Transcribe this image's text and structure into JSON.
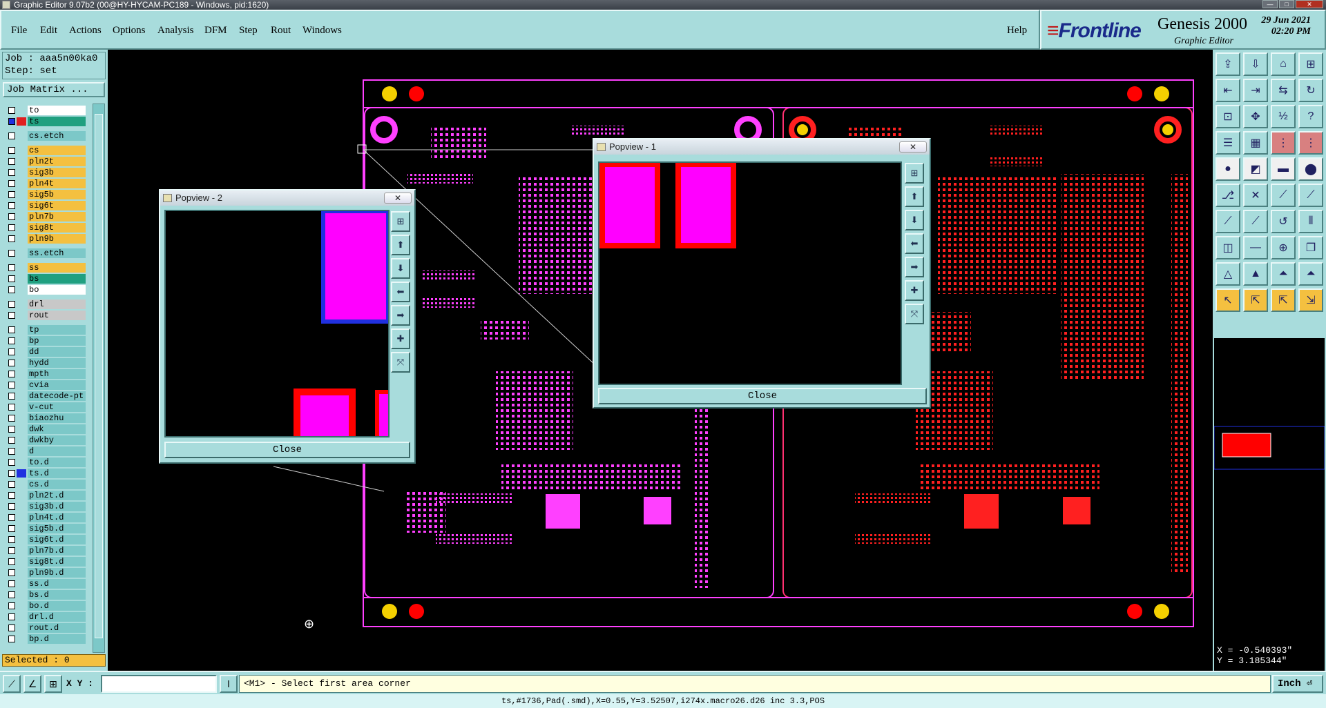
{
  "window": {
    "title": "Graphic Editor 9.07b2 (00@HY-HYCAM-PC189 - Windows, pid:1620)"
  },
  "menu": {
    "items": [
      "File",
      "Edit",
      "Actions",
      "Options",
      "Analysis",
      "DFM",
      "Step",
      "Rout",
      "Windows"
    ],
    "help": "Help"
  },
  "brand": {
    "logo": "Frontline",
    "product": "Genesis 2000",
    "subtitle": "Graphic Editor",
    "date": "29 Jun 2021",
    "time": "02:20 PM"
  },
  "job": {
    "job_line": "Job : aaa5n00ka0",
    "step_line": "Step: set",
    "matrix_button": "Job Matrix ..."
  },
  "layers": [
    {
      "name": "to",
      "color": "#ffffff",
      "swatch": "",
      "group": 1
    },
    {
      "name": "ts",
      "color": "#20a080",
      "swatch": "#e02020",
      "group": 1,
      "active": true
    },
    {
      "name": "cs.etch",
      "color": "#7cc8c8",
      "swatch": "",
      "group": 2
    },
    {
      "name": "cs",
      "color": "#f4c040",
      "swatch": "",
      "group": 3
    },
    {
      "name": "pln2t",
      "color": "#f4c040",
      "swatch": "",
      "group": 3
    },
    {
      "name": "sig3b",
      "color": "#f4c040",
      "swatch": "",
      "group": 3
    },
    {
      "name": "pln4t",
      "color": "#f4c040",
      "swatch": "",
      "group": 3
    },
    {
      "name": "sig5b",
      "color": "#f4c040",
      "swatch": "",
      "group": 3
    },
    {
      "name": "sig6t",
      "color": "#f4c040",
      "swatch": "",
      "group": 3
    },
    {
      "name": "pln7b",
      "color": "#f4c040",
      "swatch": "",
      "group": 3
    },
    {
      "name": "sig8t",
      "color": "#f4c040",
      "swatch": "",
      "group": 3
    },
    {
      "name": "pln9b",
      "color": "#f4c040",
      "swatch": "",
      "group": 3
    },
    {
      "name": "ss.etch",
      "color": "#7cc8c8",
      "swatch": "",
      "group": 4
    },
    {
      "name": "ss",
      "color": "#f4c040",
      "swatch": "",
      "group": 5
    },
    {
      "name": "bs",
      "color": "#20a080",
      "swatch": "",
      "group": 5
    },
    {
      "name": "bo",
      "color": "#ffffff",
      "swatch": "",
      "group": 5
    },
    {
      "name": "drl",
      "color": "#c8c8c8",
      "swatch": "",
      "group": 6
    },
    {
      "name": "rout",
      "color": "#c8c8c8",
      "swatch": "",
      "group": 6
    },
    {
      "name": "tp",
      "color": "#7cc8c8",
      "swatch": "",
      "group": 7
    },
    {
      "name": "bp",
      "color": "#7cc8c8",
      "swatch": "",
      "group": 7
    },
    {
      "name": "dd",
      "color": "#7cc8c8",
      "swatch": "",
      "group": 7
    },
    {
      "name": "hydd",
      "color": "#7cc8c8",
      "swatch": "",
      "group": 7
    },
    {
      "name": "mpth",
      "color": "#7cc8c8",
      "swatch": "",
      "group": 7
    },
    {
      "name": "cvia",
      "color": "#7cc8c8",
      "swatch": "",
      "group": 7
    },
    {
      "name": "datecode-pt",
      "color": "#7cc8c8",
      "swatch": "",
      "group": 7
    },
    {
      "name": "v-cut",
      "color": "#7cc8c8",
      "swatch": "",
      "group": 7
    },
    {
      "name": "biaozhu",
      "color": "#7cc8c8",
      "swatch": "",
      "group": 7
    },
    {
      "name": "dwk",
      "color": "#7cc8c8",
      "swatch": "",
      "group": 7
    },
    {
      "name": "dwkby",
      "color": "#7cc8c8",
      "swatch": "",
      "group": 7
    },
    {
      "name": "d",
      "color": "#7cc8c8",
      "swatch": "",
      "group": 7
    },
    {
      "name": "to.d",
      "color": "#7cc8c8",
      "swatch": "",
      "group": 7
    },
    {
      "name": "ts.d",
      "color": "#7cc8c8",
      "swatch": "#2030e0",
      "group": 7
    },
    {
      "name": "cs.d",
      "color": "#7cc8c8",
      "swatch": "",
      "group": 7
    },
    {
      "name": "pln2t.d",
      "color": "#7cc8c8",
      "swatch": "",
      "group": 7
    },
    {
      "name": "sig3b.d",
      "color": "#7cc8c8",
      "swatch": "",
      "group": 7
    },
    {
      "name": "pln4t.d",
      "color": "#7cc8c8",
      "swatch": "",
      "group": 7
    },
    {
      "name": "sig5b.d",
      "color": "#7cc8c8",
      "swatch": "",
      "group": 7
    },
    {
      "name": "sig6t.d",
      "color": "#7cc8c8",
      "swatch": "",
      "group": 7
    },
    {
      "name": "pln7b.d",
      "color": "#7cc8c8",
      "swatch": "",
      "group": 7
    },
    {
      "name": "sig8t.d",
      "color": "#7cc8c8",
      "swatch": "",
      "group": 7
    },
    {
      "name": "pln9b.d",
      "color": "#7cc8c8",
      "swatch": "",
      "group": 7
    },
    {
      "name": "ss.d",
      "color": "#7cc8c8",
      "swatch": "",
      "group": 7
    },
    {
      "name": "bs.d",
      "color": "#7cc8c8",
      "swatch": "",
      "group": 7
    },
    {
      "name": "bo.d",
      "color": "#7cc8c8",
      "swatch": "",
      "group": 7
    },
    {
      "name": "drl.d",
      "color": "#7cc8c8",
      "swatch": "",
      "group": 7
    },
    {
      "name": "rout.d",
      "color": "#7cc8c8",
      "swatch": "",
      "group": 7
    },
    {
      "name": "bp.d",
      "color": "#7cc8c8",
      "swatch": "",
      "group": 7
    }
  ],
  "selected": "Selected : 0",
  "popview1": {
    "title": "Popview - 1",
    "close": "Close",
    "close_x": "✕"
  },
  "popview2": {
    "title": "Popview - 2",
    "close": "Close",
    "close_x": "✕"
  },
  "coords": {
    "x": "X = -0.540393\"",
    "y": "Y = 3.185344\""
  },
  "statusbar": {
    "xy_label": "X Y :",
    "xy_value": "",
    "prompt": "<M1> - Select first area corner",
    "units": "Inch"
  },
  "info_line": "ts,#1736,Pad(.smd),X=0.55,Y=3.52507,i274x.macro26.d26 inc 3.3,POS",
  "colors": {
    "panel": "#a8dcdc",
    "magenta": "#ff00ff",
    "red": "#ff0000",
    "yellow": "#f4d000"
  }
}
